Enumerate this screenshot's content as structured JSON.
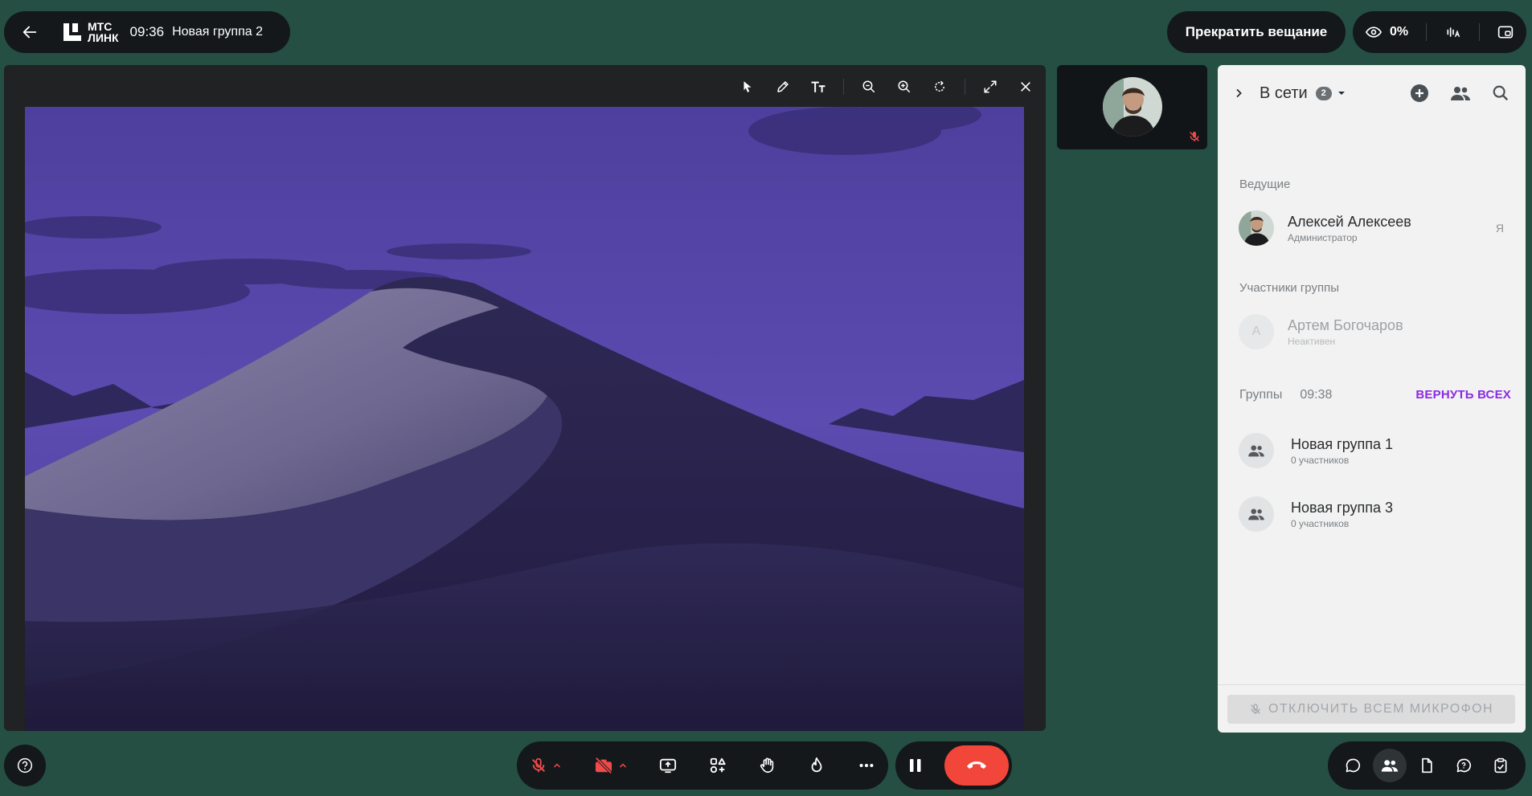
{
  "header": {
    "logo_line1": "МТС",
    "logo_line2": "ЛИНК",
    "time": "09:36",
    "room_name": "Новая группа 2",
    "stop_broadcast_label": "Прекратить вещание",
    "viewers_percent": "0%"
  },
  "stage": {
    "tools": [
      "pointer-icon",
      "pencil-icon",
      "text-icon",
      "zoom-out-icon",
      "zoom-in-icon",
      "rotate-icon",
      "expand-icon",
      "close-icon"
    ]
  },
  "panel": {
    "title": "В сети",
    "online_count": "2",
    "section_presenters": "Ведущие",
    "presenter": {
      "name": "Алексей Алексеев",
      "role": "Администратор",
      "me_label": "Я"
    },
    "section_members": "Участники группы",
    "member": {
      "initial": "А",
      "name": "Артем Богочаров",
      "status": "Неактивен"
    },
    "groups_label": "Группы",
    "groups_timer": "09:38",
    "return_all_label": "ВЕРНУТЬ ВСЕХ",
    "groups": [
      {
        "name": "Новая группа 1",
        "count": "0 участников"
      },
      {
        "name": "Новая группа 3",
        "count": "0 участников"
      }
    ],
    "mute_all_label": "ОТКЛЮЧИТЬ ВСЕМ МИКРОФОН"
  },
  "colors": {
    "background": "#244f42",
    "hangup": "#f2463a",
    "muted_red": "#f04a4a",
    "accent_purple": "#8a2be2"
  }
}
